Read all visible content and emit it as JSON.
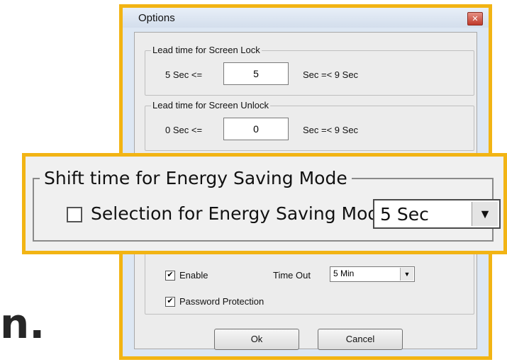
{
  "background": {
    "caption_fragment": "n."
  },
  "dialog": {
    "title": "Options",
    "close_glyph": "✕",
    "screen_lock": {
      "legend": "Lead time for Screen Lock",
      "min_label": "5 Sec  <=",
      "value": "5",
      "max_label": "Sec   =<  9 Sec"
    },
    "screen_unlock": {
      "legend": "Lead time for Screen Unlock",
      "min_label": "0 Sec  <=",
      "value": "0",
      "max_label": "Sec   =<  9 Sec"
    },
    "screensaver": {
      "enable_label": "Enable",
      "enable_checked": true,
      "timeout_label": "Time Out",
      "timeout_value": "5 Min",
      "password_label": "Password Protection",
      "password_checked": true
    },
    "buttons": {
      "ok": "Ok",
      "cancel": "Cancel"
    }
  },
  "callout": {
    "legend": "Shift time for Energy Saving Mode",
    "checkbox_label": "Selection for Energy Saving Mode",
    "checkbox_checked": false,
    "select_value": "5 Sec",
    "select_arrow": "▼"
  },
  "colors": {
    "highlight": "#f2b414",
    "window_frame": "#dde7f3"
  }
}
